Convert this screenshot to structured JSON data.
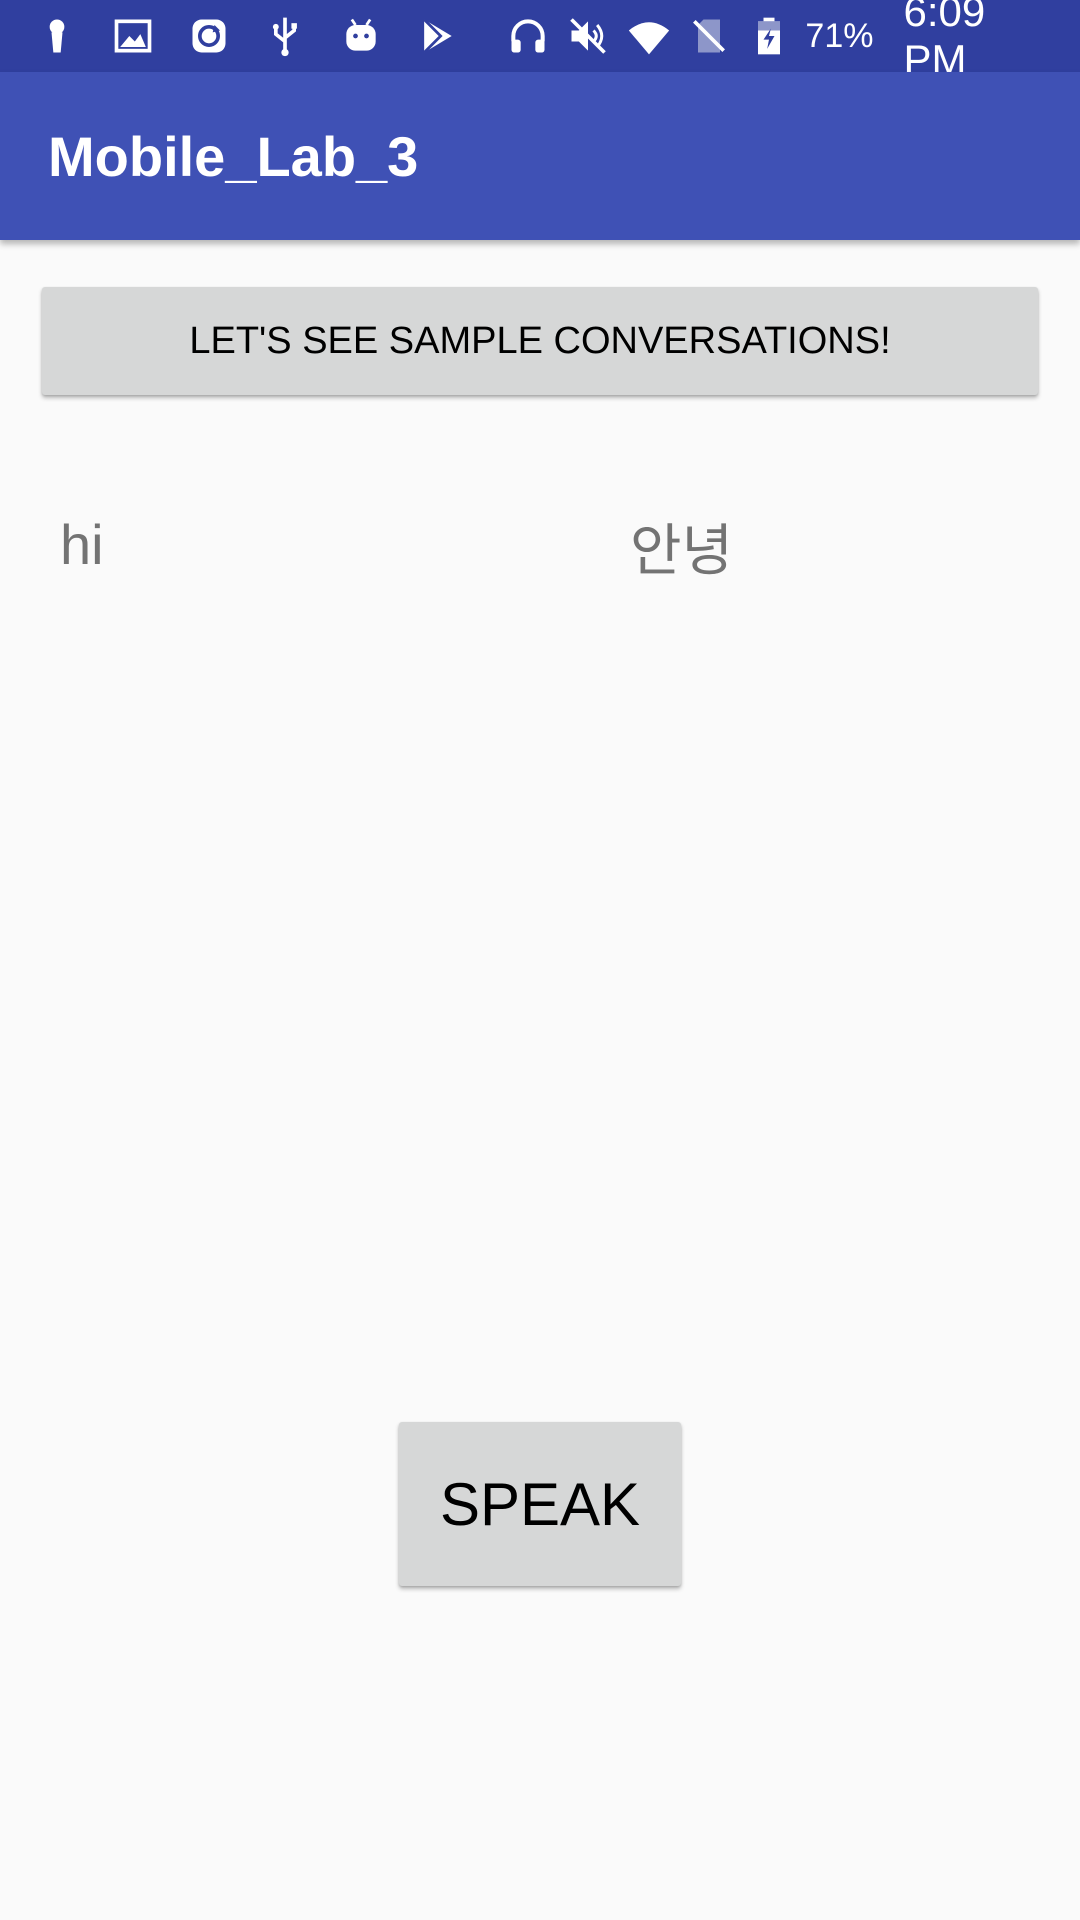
{
  "status_bar": {
    "left_icons": [
      "keyhole-icon",
      "image-icon",
      "sync-icon",
      "usb-icon",
      "android-icon",
      "play-store-icon"
    ],
    "right_icons": [
      "headphones-icon",
      "mute-icon",
      "wifi-icon",
      "no-sim-icon",
      "battery-charging-icon"
    ],
    "battery_percent": "71%",
    "time": "6:09 PM",
    "background_color": "#303f9f"
  },
  "app_bar": {
    "title": "Mobile_Lab_3",
    "background_color": "#3f51b5"
  },
  "main": {
    "sample_button_label": "LET'S SEE SAMPLE CONVERSATIONS!",
    "source_text": "hi",
    "translated_text": "안녕",
    "speak_button_label": "SPEAK"
  }
}
